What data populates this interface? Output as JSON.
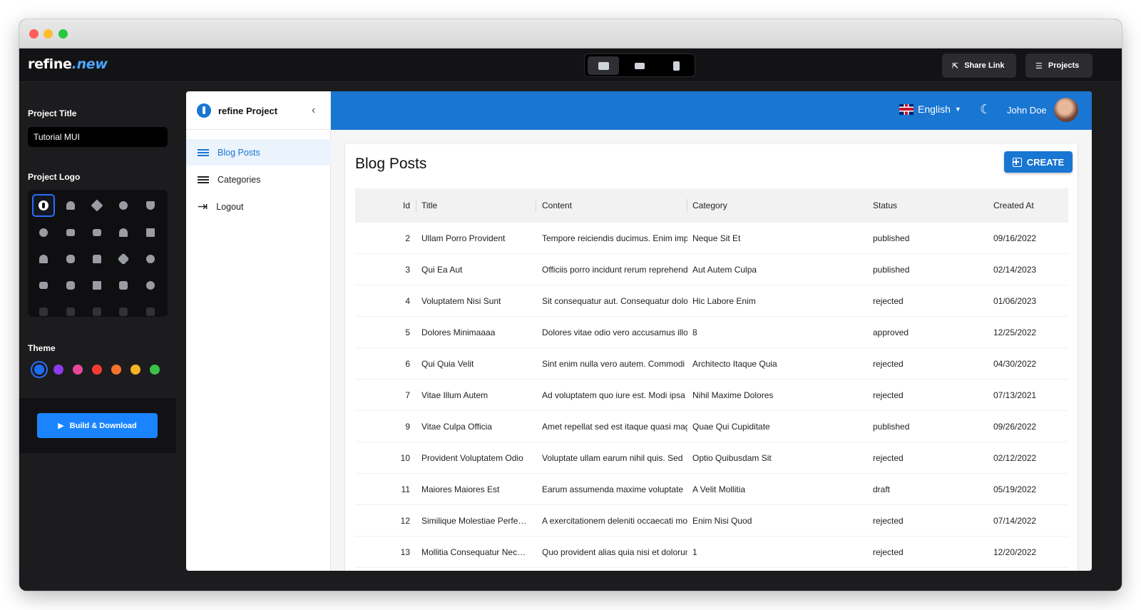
{
  "app": {
    "brand_main": "refine",
    "brand_accent": ".new",
    "share_link": "Share Link",
    "projects": "Projects"
  },
  "left_panel": {
    "project_title_label": "Project Title",
    "project_title_value": "Tutorial MUI",
    "project_logo_label": "Project Logo",
    "theme_label": "Theme",
    "theme_colors": [
      "#1a6ff5",
      "#8b3cf0",
      "#e8489a",
      "#f23c32",
      "#f5742a",
      "#f5b324",
      "#3cc04a"
    ],
    "build_button": "Build & Download"
  },
  "preview": {
    "sider_title": "refine Project",
    "menu": [
      {
        "label": "Blog Posts",
        "active": true
      },
      {
        "label": "Categories",
        "active": false
      },
      {
        "label": "Logout",
        "active": false
      }
    ],
    "header": {
      "language": "English",
      "user_name": "John Doe"
    },
    "page_title": "Blog Posts",
    "create_button": "CREATE",
    "table": {
      "columns": [
        "Id",
        "Title",
        "Content",
        "Category",
        "Status",
        "Created At"
      ],
      "rows": [
        {
          "id": "2",
          "title": "Ullam Porro Provident",
          "content": "Tempore reiciendis ducimus. Enim impedit",
          "category": "Neque Sit Et",
          "status": "published",
          "created_at": "09/16/2022"
        },
        {
          "id": "3",
          "title": "Qui Ea Aut",
          "content": "Officiis porro incidunt rerum reprehenderit",
          "category": "Aut Autem Culpa",
          "status": "published",
          "created_at": "02/14/2023"
        },
        {
          "id": "4",
          "title": "Voluptatem Nisi Sunt",
          "content": "Sit consequatur aut. Consequatur dolor",
          "category": "Hic Labore Enim",
          "status": "rejected",
          "created_at": "01/06/2023"
        },
        {
          "id": "5",
          "title": "Dolores Minimaaaa",
          "content": "Dolores vitae odio vero accusamus illo",
          "category": "8",
          "status": "approved",
          "created_at": "12/25/2022"
        },
        {
          "id": "6",
          "title": "Qui Quia Velit",
          "content": "Sint enim nulla vero autem. Commodi",
          "category": "Architecto Itaque Quia",
          "status": "rejected",
          "created_at": "04/30/2022"
        },
        {
          "id": "7",
          "title": "Vitae Illum Autem",
          "content": "Ad voluptatem quo iure est. Modi ipsa",
          "category": "Nihil Maxime Dolores",
          "status": "rejected",
          "created_at": "07/13/2021"
        },
        {
          "id": "9",
          "title": "Vitae Culpa Officia",
          "content": "Amet repellat sed est itaque quasi magni",
          "category": "Quae Qui Cupiditate",
          "status": "published",
          "created_at": "09/26/2022"
        },
        {
          "id": "10",
          "title": "Provident Voluptatem Odio",
          "content": "Voluptate ullam earum nihil quis. Sed",
          "category": "Optio Quibusdam Sit",
          "status": "rejected",
          "created_at": "02/12/2022"
        },
        {
          "id": "11",
          "title": "Maiores Maiores Est",
          "content": "Earum assumenda maxime voluptate",
          "category": "A Velit Mollitia",
          "status": "draft",
          "created_at": "05/19/2022"
        },
        {
          "id": "12",
          "title": "Similique Molestiae Perfe…",
          "content": "A exercitationem deleniti occaecati modi",
          "category": "Enim Nisi Quod",
          "status": "rejected",
          "created_at": "07/14/2022"
        },
        {
          "id": "13",
          "title": "Mollitia Consequatur Nec…",
          "content": "Quo provident alias quia nisi et dolorum",
          "category": "1",
          "status": "rejected",
          "created_at": "12/20/2022"
        }
      ]
    }
  }
}
